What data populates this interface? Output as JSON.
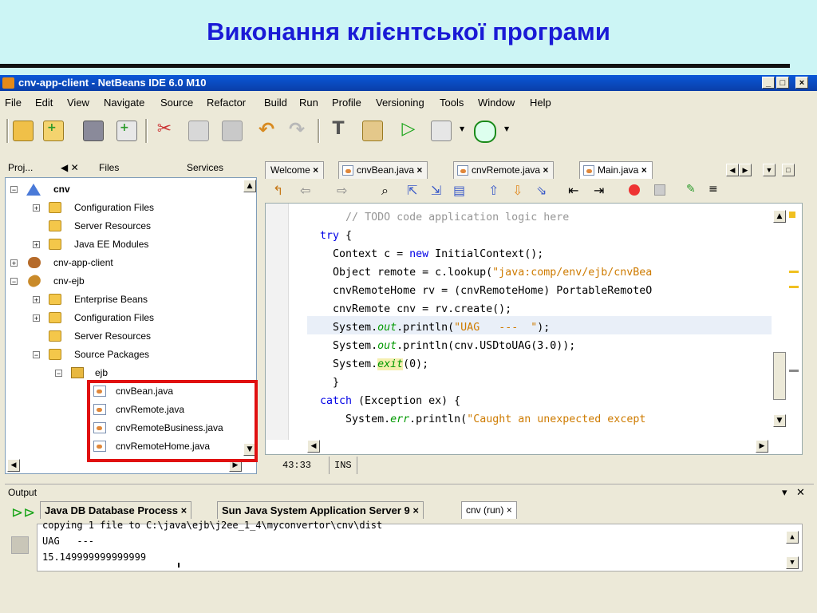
{
  "slide": {
    "title": "Виконання клієнтської програми"
  },
  "window": {
    "title": "cnv-app-client - NetBeans IDE 6.0 M10",
    "minimize": "_",
    "maximize": "□",
    "close": "×"
  },
  "menu": [
    "File",
    "Edit",
    "View",
    "Navigate",
    "Source",
    "Refactor",
    "Build",
    "Run",
    "Profile",
    "Versioning",
    "Tools",
    "Window",
    "Help"
  ],
  "toolbar": {
    "icons": [
      "new-project-icon",
      "new-file-icon",
      "save-all-icon",
      "add-icon",
      "cut-icon",
      "copy-icon",
      "paste-icon",
      "undo-icon",
      "redo-icon",
      "build-icon",
      "clean-build-icon",
      "run-icon",
      "debug-icon",
      "profile-icon"
    ]
  },
  "project_panel": {
    "tabs": {
      "projects": "Proj...",
      "projects_ctrl": "◀ ✕",
      "files": "Files",
      "services": "Services"
    },
    "tree": [
      {
        "label": "cnv",
        "level": 0,
        "icon": "project-icon",
        "expanded": true,
        "bold": true
      },
      {
        "label": "Configuration Files",
        "level": 1,
        "icon": "folder-icon"
      },
      {
        "label": "Server Resources",
        "level": 1,
        "icon": "folder-icon"
      },
      {
        "label": "Java EE Modules",
        "level": 1,
        "icon": "folder-icon"
      },
      {
        "label": "cnv-app-client",
        "level": 0,
        "icon": "coffee-icon"
      },
      {
        "label": "cnv-ejb",
        "level": 0,
        "icon": "bean-icon",
        "expanded": true
      },
      {
        "label": "Enterprise Beans",
        "level": 1,
        "icon": "folder-icon"
      },
      {
        "label": "Configuration Files",
        "level": 1,
        "icon": "folder-icon"
      },
      {
        "label": "Server Resources",
        "level": 1,
        "icon": "folder-icon"
      },
      {
        "label": "Source Packages",
        "level": 1,
        "icon": "folder-icon",
        "expanded": true
      },
      {
        "label": "ejb",
        "level": 2,
        "icon": "package-icon",
        "expanded": true
      },
      {
        "label": "cnvBean.java",
        "level": 3,
        "icon": "java-file-icon"
      },
      {
        "label": "cnvRemote.java",
        "level": 3,
        "icon": "java-file-icon"
      },
      {
        "label": "cnvRemoteBusiness.java",
        "level": 3,
        "icon": "java-file-icon"
      },
      {
        "label": "cnvRemoteHome.java",
        "level": 3,
        "icon": "java-file-icon"
      }
    ]
  },
  "editor": {
    "tabs": [
      {
        "label": "Welcome",
        "close": "×"
      },
      {
        "label": "cnvBean.java",
        "close": "×"
      },
      {
        "label": "cnvRemote.java",
        "close": "×"
      },
      {
        "label": "Main.java",
        "close": "×",
        "active": true
      }
    ],
    "code": [
      {
        "indent": "      ",
        "parts": [
          {
            "t": "// TODO code application logic here",
            "c": "cmt"
          }
        ]
      },
      {
        "indent": "  ",
        "parts": [
          {
            "t": "try",
            "c": "kw"
          },
          {
            "t": " {",
            "c": ""
          }
        ]
      },
      {
        "indent": "    ",
        "parts": [
          {
            "t": "Context c = ",
            "c": ""
          },
          {
            "t": "new",
            "c": "kw"
          },
          {
            "t": " InitialContext();",
            "c": ""
          }
        ]
      },
      {
        "indent": "    ",
        "parts": [
          {
            "t": "Object remote = c.lookup(",
            "c": ""
          },
          {
            "t": "\"java:comp/env/ejb/cnvBea",
            "c": "str"
          }
        ]
      },
      {
        "indent": "    ",
        "parts": [
          {
            "t": "cnvRemoteHome rv = (cnvRemoteHome) PortableRemoteO",
            "c": ""
          }
        ]
      },
      {
        "indent": "    ",
        "parts": [
          {
            "t": "cnvRemote cnv = rv.create();",
            "c": ""
          }
        ]
      },
      {
        "indent": "    ",
        "parts": [
          {
            "t": "System.",
            "c": ""
          },
          {
            "t": "out",
            "c": "fld"
          },
          {
            "t": ".println(",
            "c": ""
          },
          {
            "t": "\"UAG   ---  \"",
            "c": "str"
          },
          {
            "t": ");",
            "c": ""
          }
        ]
      },
      {
        "indent": "    ",
        "parts": [
          {
            "t": "System.",
            "c": ""
          },
          {
            "t": "out",
            "c": "fld"
          },
          {
            "t": ".println(cnv.USDtoUAG(3.0));",
            "c": ""
          }
        ]
      },
      {
        "indent": "    ",
        "parts": [
          {
            "t": "System.",
            "c": ""
          },
          {
            "t": "exit",
            "c": "fld"
          },
          {
            "t": "(0);",
            "c": ""
          }
        ]
      },
      {
        "indent": "    ",
        "parts": [
          {
            "t": "}",
            "c": ""
          }
        ]
      },
      {
        "indent": "  ",
        "parts": [
          {
            "t": "catch",
            "c": "kw"
          },
          {
            "t": " (Exception ex) {",
            "c": ""
          }
        ]
      },
      {
        "indent": "      ",
        "parts": [
          {
            "t": "System.",
            "c": ""
          },
          {
            "t": "err",
            "c": "fld"
          },
          {
            "t": ".println(",
            "c": ""
          },
          {
            "t": "\"Caught an unexpected except",
            "c": "str"
          }
        ]
      }
    ],
    "status": {
      "position": "43:33",
      "mode": "INS"
    }
  },
  "output": {
    "title": "Output",
    "tabs": [
      {
        "label": "Java DB Database Process",
        "close": "×"
      },
      {
        "label": "Sun Java System Application Server 9",
        "close": "×"
      },
      {
        "label": "cnv (run)",
        "close": "×",
        "active": true
      }
    ],
    "lines": [
      "copying 1 file to C:\\java\\ejb\\j2ee_1_4\\myconvertor\\cnv\\dist",
      "UAG   ---",
      "15.149999999999999"
    ]
  },
  "colors": {
    "accent": "#0a58d8",
    "slide_bg": "#ccf5f5",
    "slide_title": "#1a1ad6",
    "highlight": "#e01010"
  }
}
